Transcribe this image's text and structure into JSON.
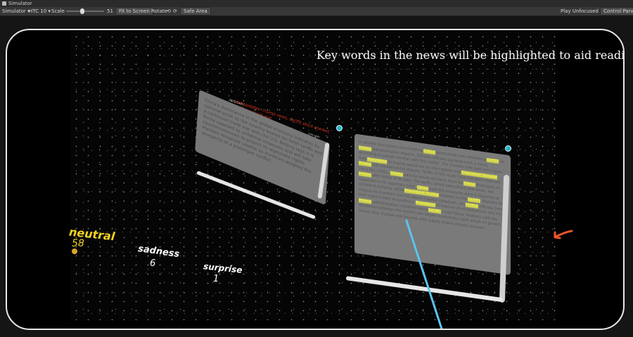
{
  "window": {
    "title": "Simulator"
  },
  "toolbar": {
    "mode": "Simulator",
    "device": "HTC 10",
    "scale_label": "Scale",
    "scale_value": "51",
    "fit_button": "Fit to Screen",
    "rotate_label": "Rotate",
    "safe_area": "Safe Area",
    "play_mode": "Play Unfocused",
    "control_panel": "Control Panel"
  },
  "scene": {
    "caption": "Key words in the news will be highlighted to aid reading",
    "article1": {
      "headline": "Live updates: Trump news, tariffs stock market, US-China trade war",
      "date": "2025/04/07",
      "source": "cnn.com",
      "body": "China's dominance in the global economy indicates its national pride as the country braces for fresh tariffs and a continued trade war with the U.S. Beijing says it is firmly opposed to unilateral measures and will take countermeasures to protect its legitimate rights. Markets remained volatile as investors weighed the prospects of a prolonged conflict."
    },
    "article2": {
      "segments": [
        {
          "t": "In private discussions hours before ",
          "h": false
        },
        {
          "t": "China",
          "h": true
        },
        {
          "t": " announced new retaliatory ",
          "h": false
        },
        {
          "t": "tariffs",
          "h": true
        },
        {
          "t": " on ",
          "h": false
        },
        {
          "t": "Trump",
          "h": true
        },
        {
          "t": " administration imports, Chinese officials signaled such a move, according to people familiar with the matter. The Chinese side said once again that ",
          "h": false
        },
        {
          "t": "President",
          "h": true
        },
        {
          "t": " Xi Jinping would not be intimidated and ",
          "h": false
        },
        {
          "t": "President Donald Trump",
          "h": true
        },
        {
          "t": " has escalated the dispute. Tariffs of this scale have not been imposed since the 1930s. ",
          "h": false
        },
        {
          "t": "Trump",
          "h": true
        },
        {
          "t": " said he would not back down as ",
          "h": false
        },
        {
          "t": "China",
          "h": true
        },
        {
          "t": " fired back on ",
          "h": false
        },
        {
          "t": "Friday",
          "h": true
        },
        {
          "t": " with levies of its own. The tariffs, which take effect next week, are expected to hit exporters hard. ",
          "h": false
        },
        {
          "t": "China",
          "h": true
        },
        {
          "t": " said the measures were a response to unilateral bullying, while ",
          "h": false
        },
        {
          "t": "President Trump",
          "h": true
        },
        {
          "t": " insisted on the ",
          "h": false
        },
        {
          "t": "tariffs",
          "h": true
        },
        {
          "t": ". Markets fell sharply as investors worried about a global slowdown. On ",
          "h": false
        },
        {
          "t": "Friday",
          "h": true
        },
        {
          "t": " officials from both sides traded accusations. ",
          "h": false
        },
        {
          "t": "President",
          "h": true
        },
        {
          "t": " Xi warned of consequences and the ",
          "h": false
        },
        {
          "t": "Trump",
          "h": true
        },
        {
          "t": " administration signalled more ",
          "h": false
        },
        {
          "t": "tariffs",
          "h": true
        },
        {
          "t": " could follow. Analysts said the escalation between the world's two largest economies could weigh on growth across Asia, Europe and beyond, with supply chains already strained.",
          "h": false
        }
      ]
    },
    "emotions": [
      {
        "label": "neutral",
        "value": "58",
        "color": "#f2d21f"
      },
      {
        "label": "sadness",
        "value": "6",
        "color": "#ffffff"
      },
      {
        "label": "surprise",
        "value": "1",
        "color": "#ffffff"
      }
    ],
    "colors": {
      "accent_arrow": "#e8542c",
      "highlight": "#d9d94a",
      "ray": "#5bc4ee",
      "headline": "#d4341f"
    }
  }
}
